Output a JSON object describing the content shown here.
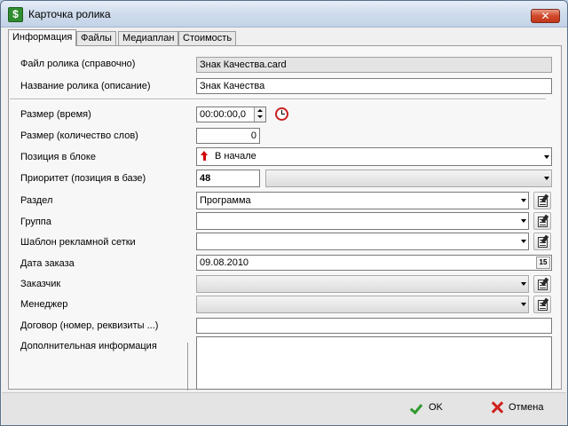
{
  "window": {
    "title": "Карточка ролика",
    "app_icon_glyph": "$",
    "close_glyph": "✕"
  },
  "tabs": [
    "Информация",
    "Файлы",
    "Медиаплан",
    "Стоимость"
  ],
  "form": {
    "file": {
      "label": "Файл ролика (справочно)",
      "value": "Знак Качества.card"
    },
    "name": {
      "label": "Название ролика (описание)",
      "value": "Знак Качества"
    },
    "size_time": {
      "label": "Размер (время)",
      "value": "00:00:00,0"
    },
    "size_words": {
      "label": "Размер (количество слов)",
      "value": "0"
    },
    "position": {
      "label": "Позиция в блоке",
      "value": "В начале"
    },
    "priority": {
      "label": "Приоритет (позиция в базе)",
      "value": "48",
      "combo_value": ""
    },
    "section": {
      "label": "Раздел",
      "value": "Программа"
    },
    "group": {
      "label": "Группа",
      "value": ""
    },
    "template": {
      "label": "Шаблон рекламной сетки",
      "value": ""
    },
    "order_date": {
      "label": "Дата заказа",
      "value": "09.08.2010",
      "calendar_glyph": "15"
    },
    "customer": {
      "label": "Заказчик",
      "value": ""
    },
    "manager": {
      "label": "Менеджер",
      "value": ""
    },
    "contract": {
      "label": "Договор (номер, реквизиты ...)",
      "value": ""
    },
    "extra": {
      "label": "Дополнительная информация",
      "value": ""
    }
  },
  "buttons": {
    "ok": "OK",
    "cancel": "Отмена"
  },
  "colors": {
    "titlebar": "#cfdcec",
    "close": "#c2371a",
    "ok_check": "#2f9a2f",
    "cancel_x": "#d02020"
  }
}
